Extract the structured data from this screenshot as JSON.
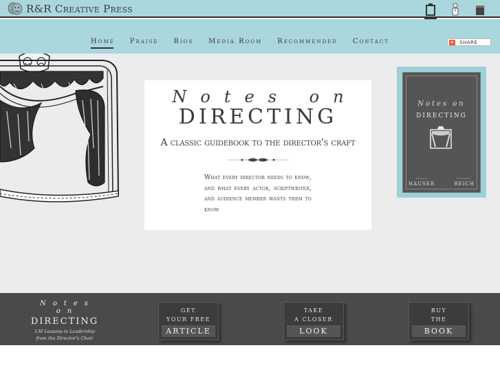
{
  "header": {
    "brand_name": "R&R Creative Press",
    "icons": [
      "book-icon",
      "chef-icon",
      "document-icon"
    ]
  },
  "nav": {
    "items": [
      {
        "label": "Home",
        "active": true
      },
      {
        "label": "Praise",
        "active": false
      },
      {
        "label": "Bios",
        "active": false
      },
      {
        "label": "Media Room",
        "active": false
      },
      {
        "label": "Recommended",
        "active": false
      },
      {
        "label": "Contact",
        "active": false
      }
    ],
    "share_label": "SHARE"
  },
  "hero": {
    "notes_on": "Notes on",
    "directing": "DIRECTING",
    "tagline": "A classic guidebook to the director's craft",
    "description": "What every director needs to know, and what every actor, scriptwriter, and audience member wants them to know"
  },
  "book_cover": {
    "notes_on": "Notes on",
    "directing": "DIRECTING",
    "author1_first": "FRANK",
    "author1_last": "HAUSER",
    "author2_first": "RUSSELL",
    "author2_last": "REICH"
  },
  "footer": {
    "notes_on": "Notes on",
    "directing": "DIRECTING",
    "sub_line1": "130 Lessons in Leadership",
    "sub_line2": "from the Director's Chair",
    "ctas": [
      {
        "top1": "GET",
        "top2": "YOUR FREE",
        "main": "ARTICLE"
      },
      {
        "top1": "TAKE",
        "top2": "A CLOSER",
        "main": "LOOK"
      },
      {
        "top1": "BUY",
        "top2": "THE",
        "main": "BOOK"
      }
    ]
  },
  "colors": {
    "header_bg": "#a9d7dd",
    "main_bg": "#ececec",
    "footer_bg": "#4a4a4a",
    "book_frame": "#9fd0d8"
  }
}
